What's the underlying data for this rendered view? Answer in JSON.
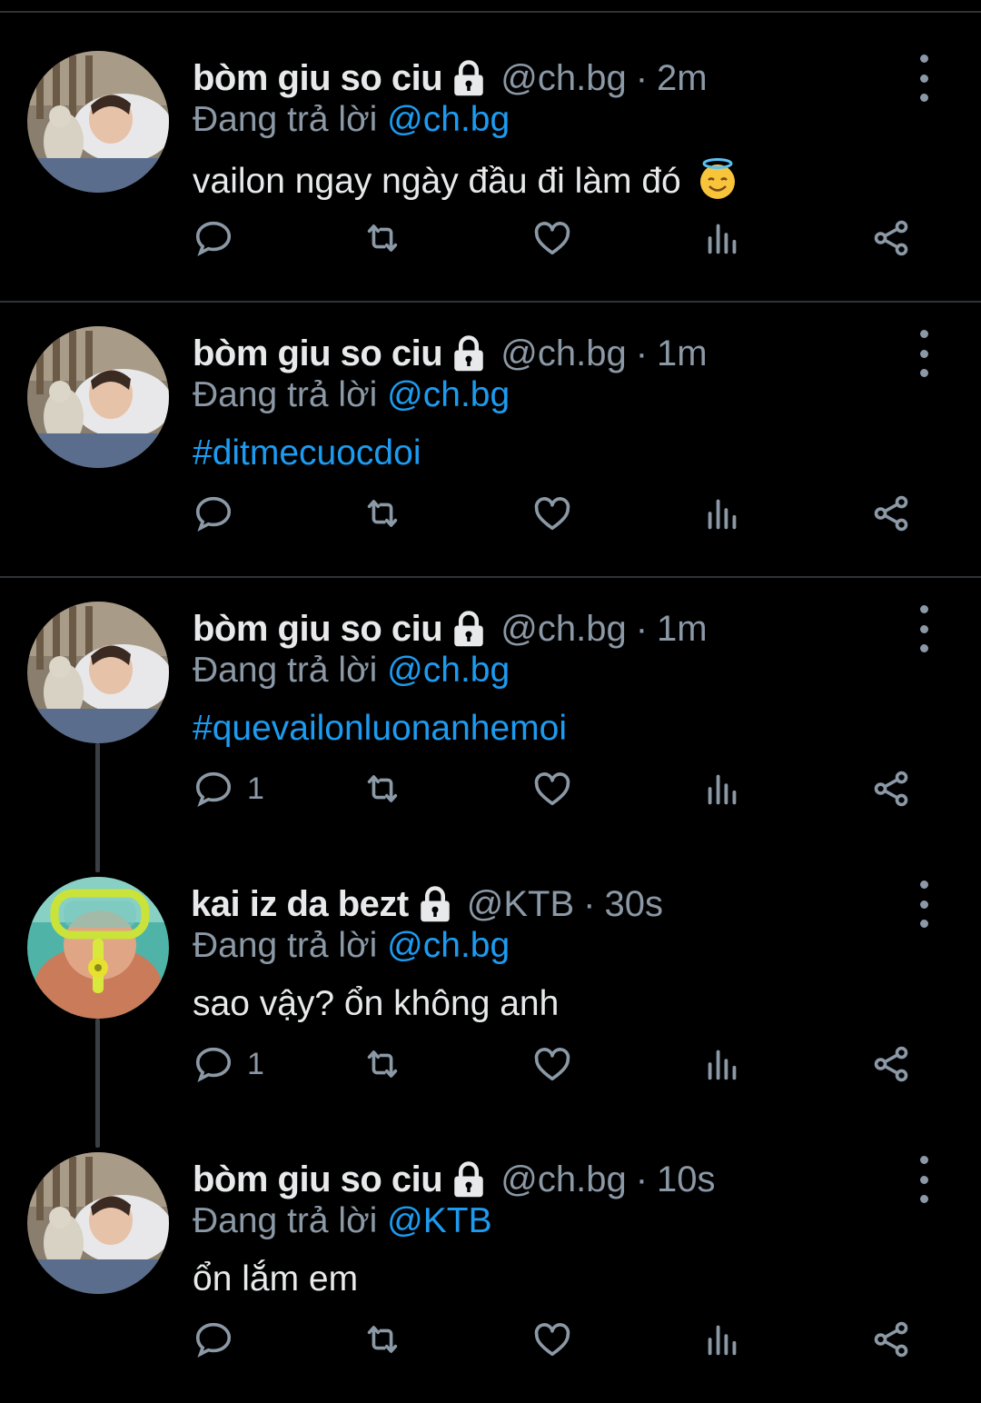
{
  "colors": {
    "background": "#000000",
    "text": "#e7e9ea",
    "muted": "#8b98a5",
    "link": "#1d9bf0",
    "divider": "#2f3336"
  },
  "reply_prefix": "Đang trả lời",
  "tweets": [
    {
      "name": "bòm giu so ciu",
      "handle": "@ch.bg",
      "time": "2m",
      "reply_to": "@ch.bg",
      "text": "vailon ngay ngày đầu đi làm đó",
      "emoji": "smiling-face-with-halo-emoji",
      "text_is_link": false,
      "reply_count": "",
      "avatar": "sleeping-child-avatar"
    },
    {
      "name": "bòm giu so ciu",
      "handle": "@ch.bg",
      "time": "1m",
      "reply_to": "@ch.bg",
      "text": "#ditmecuocdoi",
      "text_is_link": true,
      "reply_count": "",
      "avatar": "sleeping-child-avatar"
    },
    {
      "name": "bòm giu so ciu",
      "handle": "@ch.bg",
      "time": "1m",
      "reply_to": "@ch.bg",
      "text": "#quevailonluonanhemoi",
      "text_is_link": true,
      "reply_count": "1",
      "avatar": "sleeping-child-avatar"
    },
    {
      "name": "kai iz da bezt",
      "handle": "@KTB",
      "time": "30s",
      "reply_to": "@ch.bg",
      "text": "sao vậy? ổn không anh",
      "text_is_link": false,
      "reply_count": "1",
      "avatar": "snorkel-child-avatar"
    },
    {
      "name": "bòm giu so ciu",
      "handle": "@ch.bg",
      "time": "10s",
      "reply_to": "@KTB",
      "text": "ổn lắm em",
      "text_is_link": false,
      "reply_count": "",
      "avatar": "sleeping-child-avatar"
    }
  ],
  "action_icons": [
    "reply-icon",
    "retweet-icon",
    "like-icon",
    "views-icon",
    "share-icon"
  ]
}
